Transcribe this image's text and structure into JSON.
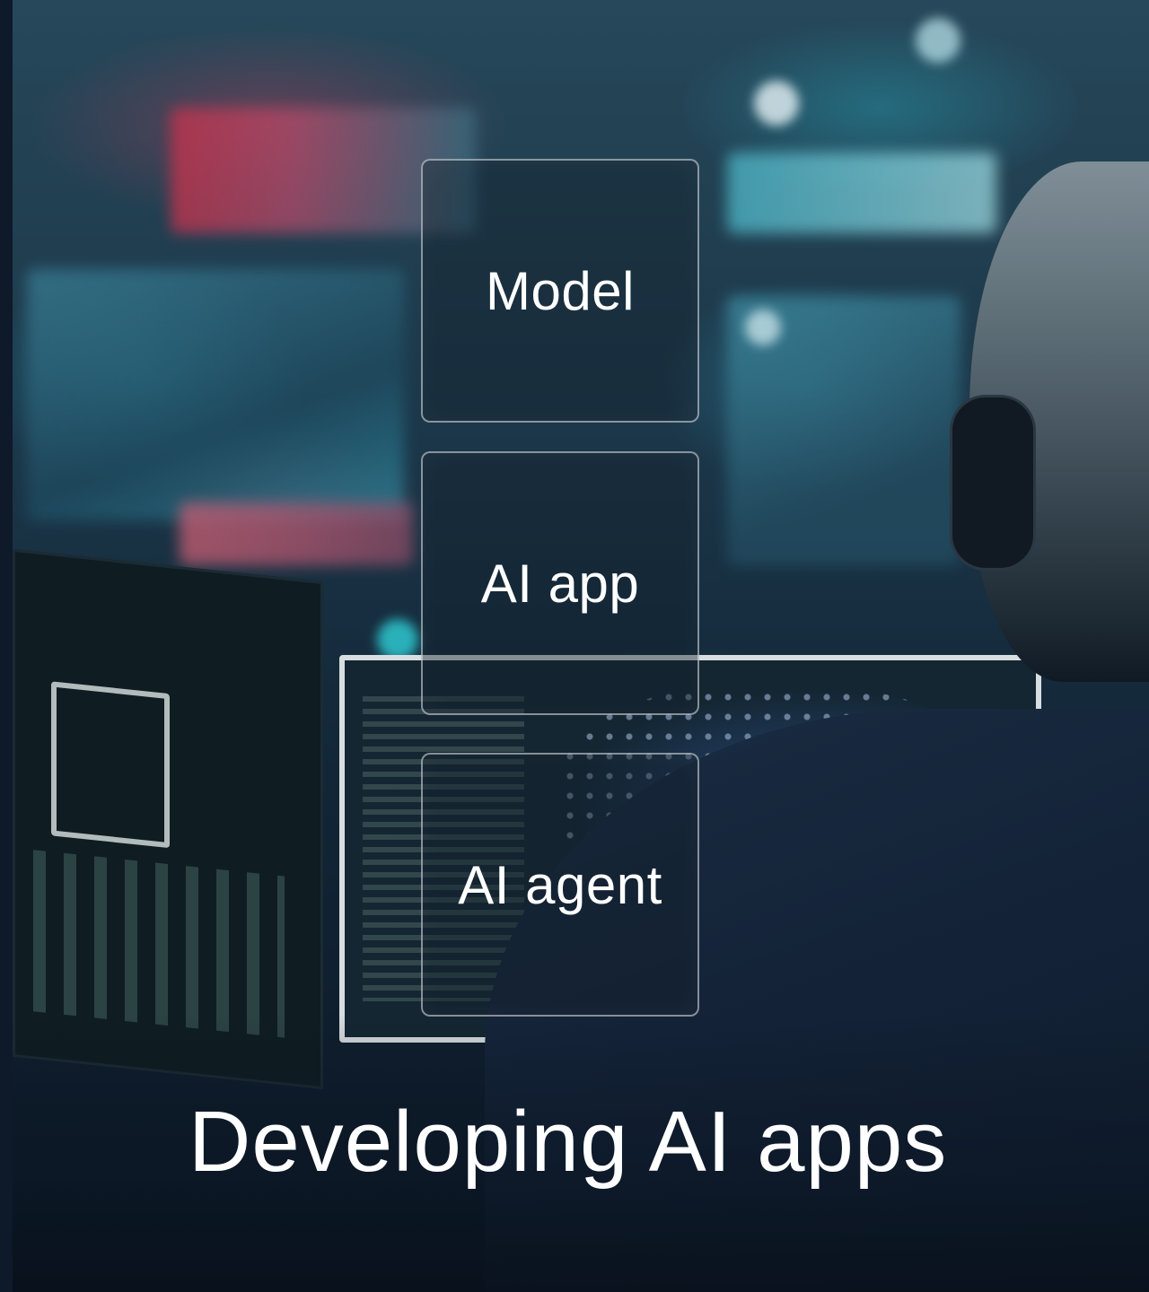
{
  "cards": [
    {
      "label": "Model"
    },
    {
      "label": "AI app"
    },
    {
      "label": "AI agent"
    }
  ],
  "headline": "Developing AI apps",
  "colors": {
    "text": "#ffffff",
    "card_border": "#e6ebf0",
    "background_dark": "#0b1624"
  }
}
